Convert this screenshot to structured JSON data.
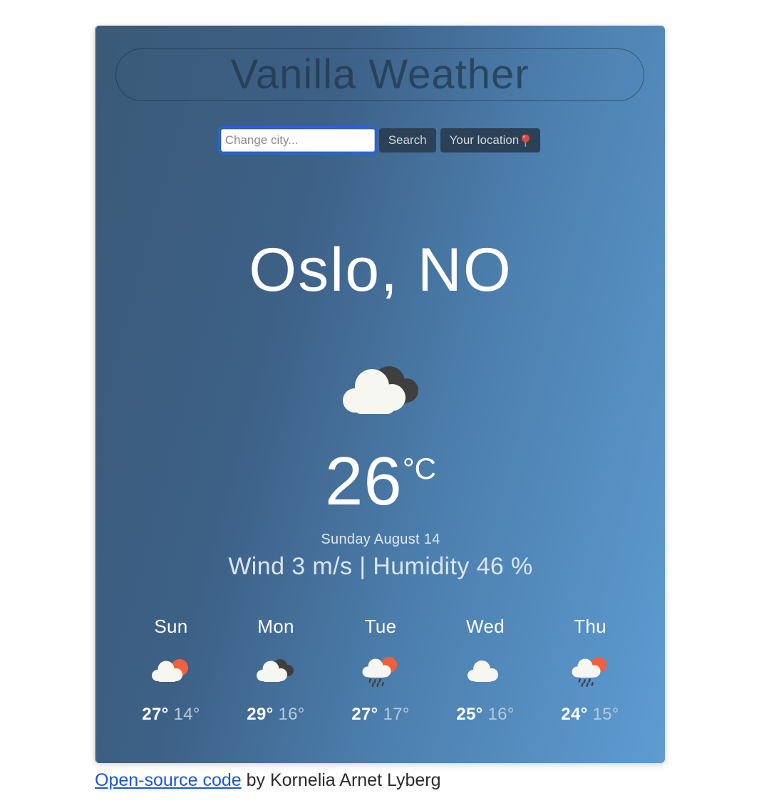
{
  "app": {
    "title": "Vanilla Weather"
  },
  "search": {
    "input_value": "",
    "placeholder": "Change city...",
    "search_label": "Search",
    "location_label": "Your location",
    "location_icon": "round-pushpin-icon"
  },
  "current": {
    "city": "Oslo, NO",
    "icon": "white-cloud-behind-dark-cloud-icon",
    "temperature": "26",
    "unit": "°C",
    "date": "Sunday August 14",
    "conditions": "Wind 3 m/s | Humidity 46 %"
  },
  "forecast": [
    {
      "day": "Sun",
      "icon": "sun-behind-cloud-icon",
      "high": "27°",
      "low": "14°"
    },
    {
      "day": "Mon",
      "icon": "cloud-behind-dark-cloud-icon",
      "high": "29°",
      "low": "16°"
    },
    {
      "day": "Tue",
      "icon": "sun-behind-rain-cloud-icon",
      "high": "27°",
      "low": "17°"
    },
    {
      "day": "Wed",
      "icon": "cloud-icon",
      "high": "25°",
      "low": "16°"
    },
    {
      "day": "Thu",
      "icon": "sun-behind-rain-cloud-icon",
      "high": "24°",
      "low": "15°"
    }
  ],
  "footer": {
    "link_text": "Open-source code",
    "credit_text": " by Kornelia Arnet Lyberg"
  },
  "colors": {
    "card_gradient_start": "#3a5a77",
    "card_gradient_end": "#5e9cd2",
    "button_bg": "#2c4056",
    "link": "#1a56d6",
    "sun": "#f1603c",
    "cloud_light": "#f5f5f0",
    "cloud_dark": "#3f3f3f",
    "focus_ring": "#2266dd"
  }
}
